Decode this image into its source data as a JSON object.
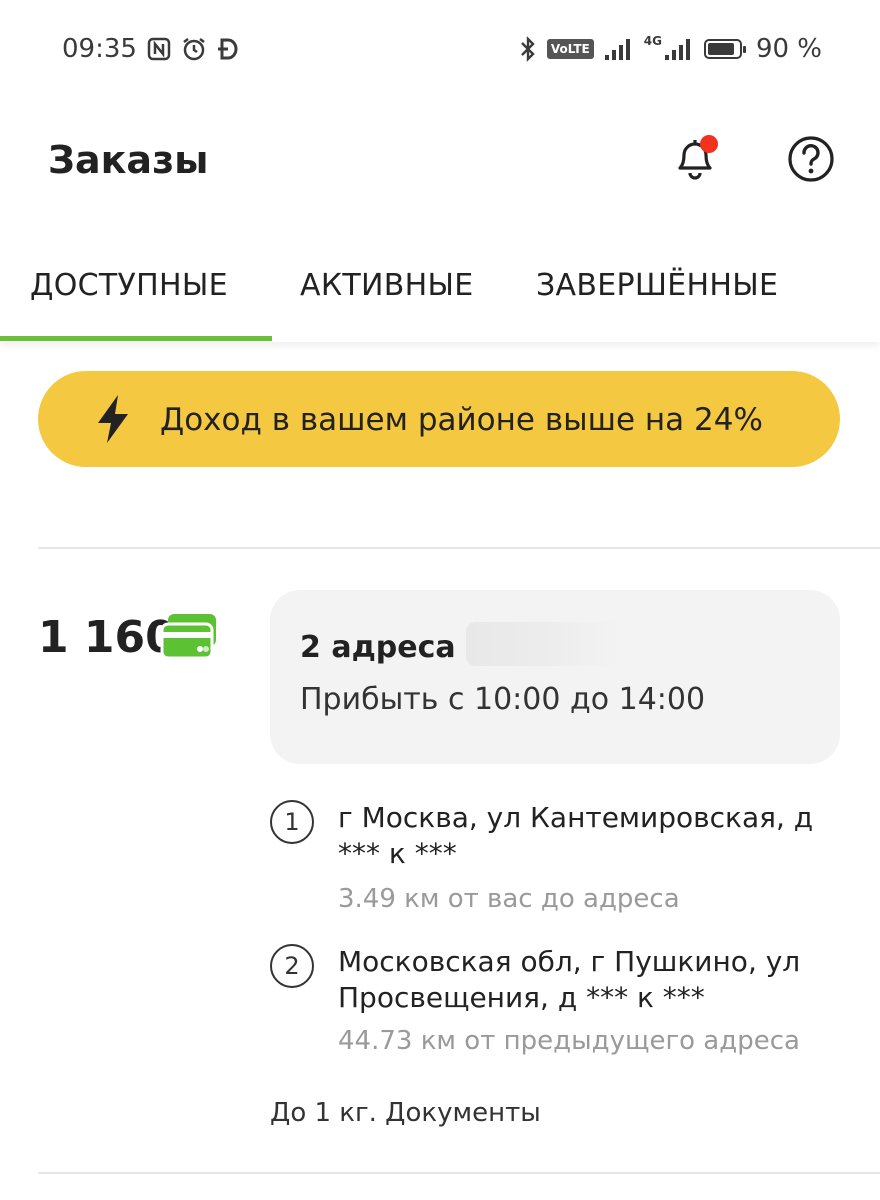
{
  "status_bar": {
    "time": "09:35",
    "left_icons": [
      "nfc-icon",
      "alarm-icon",
      "dash-icon"
    ],
    "right_icons": [
      "bluetooth-icon",
      "volte-icon",
      "signal-icon",
      "4g-signal-icon",
      "battery-icon"
    ],
    "volte_label": "VoLTE",
    "network_label": "4G",
    "battery_percent": "90 %",
    "battery_level": 0.9
  },
  "header": {
    "title": "Заказы",
    "notification_badge_color": "#f0321e",
    "icons": [
      "bell-icon",
      "help-icon"
    ]
  },
  "tabs": [
    {
      "label": "ДОСТУПНЫЕ",
      "active": true
    },
    {
      "label": "АКТИВНЫЕ",
      "active": false
    },
    {
      "label": "ЗАВЕРШЁННЫЕ",
      "active": false
    }
  ],
  "accent_color": "#6dbf3a",
  "banner": {
    "icon": "lightning-icon",
    "text": "Доход в вашем районе выше на 24%",
    "color": "#f5c842"
  },
  "order": {
    "price": "1 160",
    "payment_icon": "card-icon",
    "payment_icon_color": "#5cc234",
    "address_count": "2 адреса",
    "arrival": "Прибыть с 10:00 до 14:00",
    "stops": [
      {
        "number": "1",
        "address": "г Москва, ул Кантемировская, д *** к ***",
        "distance": "3.49 км от вас до адреса"
      },
      {
        "number": "2",
        "address": "Московская обл, г Пушкино, ул Просвещения, д *** к ***",
        "distance": "44.73 км от предыдущего адреса"
      }
    ],
    "cargo": "До 1 кг. Документы"
  }
}
